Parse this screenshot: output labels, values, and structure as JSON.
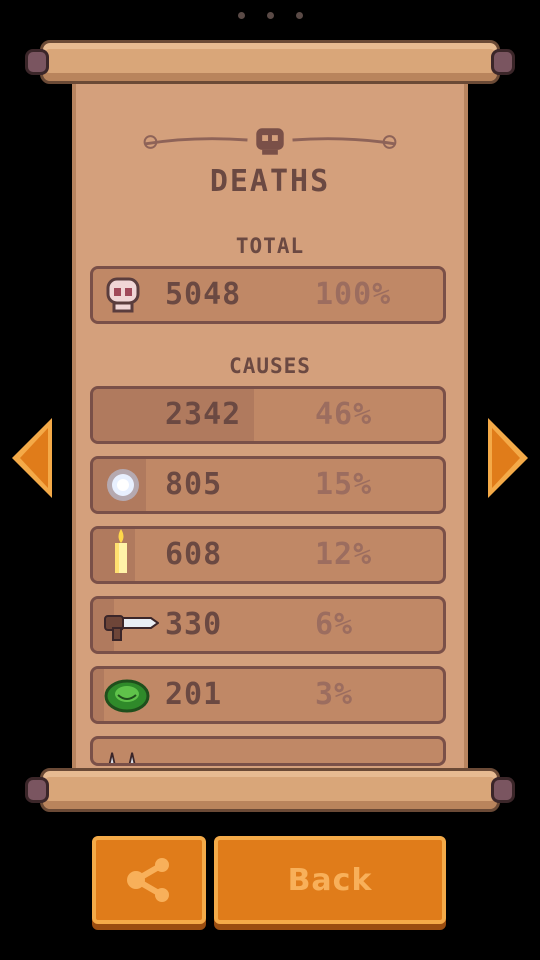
{
  "pager": {
    "pages": 3
  },
  "screen": {
    "title": "DEATHS"
  },
  "total": {
    "label": "TOTAL",
    "count": "5048",
    "percent": "100%",
    "icon": "skull-icon",
    "fill": 1.0
  },
  "causes": {
    "label": "CAUSES",
    "items": [
      {
        "count": "2342",
        "percent": "46%",
        "icon": "",
        "fill": 0.46
      },
      {
        "count": "805",
        "percent": "15%",
        "icon": "energy-orb-icon",
        "fill": 0.15
      },
      {
        "count": "608",
        "percent": "12%",
        "icon": "candle-icon",
        "fill": 0.12
      },
      {
        "count": "330",
        "percent": "6%",
        "icon": "knife-icon",
        "fill": 0.06
      },
      {
        "count": "201",
        "percent": "3%",
        "icon": "green-slime-icon",
        "fill": 0.03
      }
    ]
  },
  "buttons": {
    "share_icon": "share-icon",
    "back_label": "Back"
  },
  "colors": {
    "parchment": "#d4a07c",
    "text": "#6b4942",
    "button": "#e07c1a",
    "arrow": "#e07c1a"
  }
}
